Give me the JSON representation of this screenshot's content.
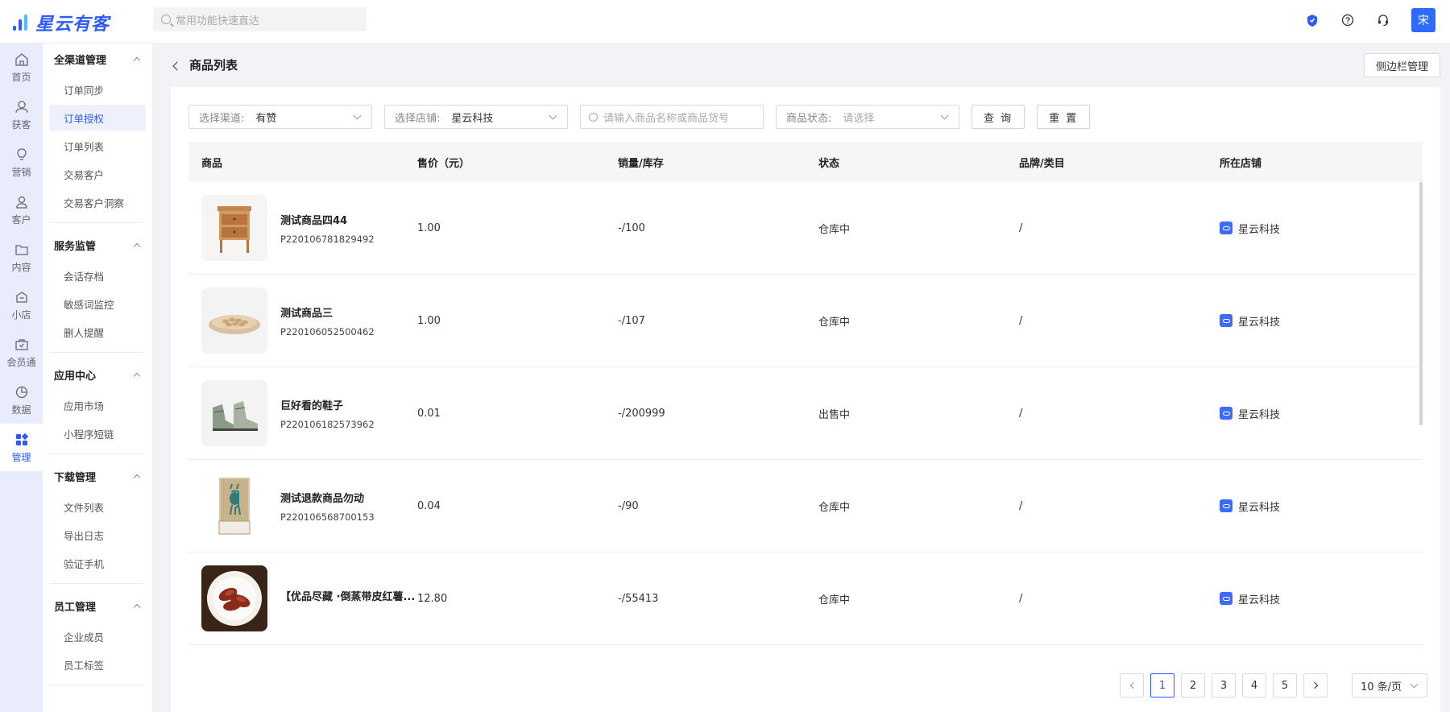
{
  "header": {
    "logo_text": "星云有客",
    "search_placeholder": "常用功能快速直达",
    "avatar_text": "宋",
    "colors": {
      "brand": "#2d5bff",
      "rail_bg": "#e9ecfa"
    }
  },
  "rail": [
    {
      "label": "首页",
      "icon": "home-icon"
    },
    {
      "label": "获客",
      "icon": "user-acquire-icon"
    },
    {
      "label": "营销",
      "icon": "bulb-icon"
    },
    {
      "label": "客户",
      "icon": "user-icon"
    },
    {
      "label": "内容",
      "icon": "folder-icon"
    },
    {
      "label": "小店",
      "icon": "shop-icon"
    },
    {
      "label": "会员通",
      "icon": "member-icon"
    },
    {
      "label": "数据",
      "icon": "pie-chart-icon"
    },
    {
      "label": "管理",
      "icon": "grid-icon"
    }
  ],
  "subnav": [
    {
      "title": "全渠道管理",
      "items": [
        "订单同步",
        "订单授权",
        "订单列表",
        "交易客户",
        "交易客户洞察"
      ]
    },
    {
      "title": "服务监管",
      "items": [
        "会话存档",
        "敏感词监控",
        "删人提醒"
      ]
    },
    {
      "title": "应用中心",
      "items": [
        "应用市场",
        "小程序短链"
      ]
    },
    {
      "title": "下载管理",
      "items": [
        "文件列表",
        "导出日志",
        "验证手机"
      ]
    },
    {
      "title": "员工管理",
      "items": [
        "企业成员",
        "员工标签"
      ]
    }
  ],
  "page": {
    "title": "商品列表",
    "sidebar_button": "侧边栏管理"
  },
  "filters": {
    "channel_label": "选择渠道:",
    "channel_value": "有赞",
    "shop_label": "选择店铺:",
    "shop_value": "星云科技",
    "search_placeholder": "请输入商品名称或商品货号",
    "status_label": "商品状态:",
    "status_placeholder": "请选择",
    "query_button": "查 询",
    "reset_button": "重 置"
  },
  "table": {
    "headers": [
      "商品",
      "售价（元）",
      "销量/库存",
      "状态",
      "品牌/类目",
      "所在店铺"
    ],
    "rows": [
      {
        "name": "测试商品四44",
        "code": "P220106781829492",
        "price": "1.00",
        "stock": "-/100",
        "status": "仓库中",
        "brand": "/",
        "shop": "星云科技",
        "thumb": "nightstand"
      },
      {
        "name": "测试商品三",
        "code": "P220106052500462",
        "price": "1.00",
        "stock": "-/107",
        "status": "仓库中",
        "brand": "/",
        "shop": "星云科技",
        "thumb": "nuts"
      },
      {
        "name": "巨好看的鞋子",
        "code": "P220106182573962",
        "price": "0.01",
        "stock": "-/200999",
        "status": "出售中",
        "brand": "/",
        "shop": "星云科技",
        "thumb": "boots"
      },
      {
        "name": "测试退款商品勿动",
        "code": "P220106568700153",
        "price": "0.04",
        "stock": "-/90",
        "status": "仓库中",
        "brand": "/",
        "shop": "星云科技",
        "thumb": "deer-art"
      },
      {
        "name": "【优品尽藏 ·倒蒸带皮红薯...",
        "code": "",
        "price": "12.80",
        "stock": "-/55413",
        "status": "仓库中",
        "brand": "/",
        "shop": "星云科技",
        "thumb": "sweet-potato"
      }
    ]
  },
  "pagination": {
    "pages": [
      "1",
      "2",
      "3",
      "4",
      "5"
    ],
    "current": "1",
    "page_size": "10 条/页"
  }
}
